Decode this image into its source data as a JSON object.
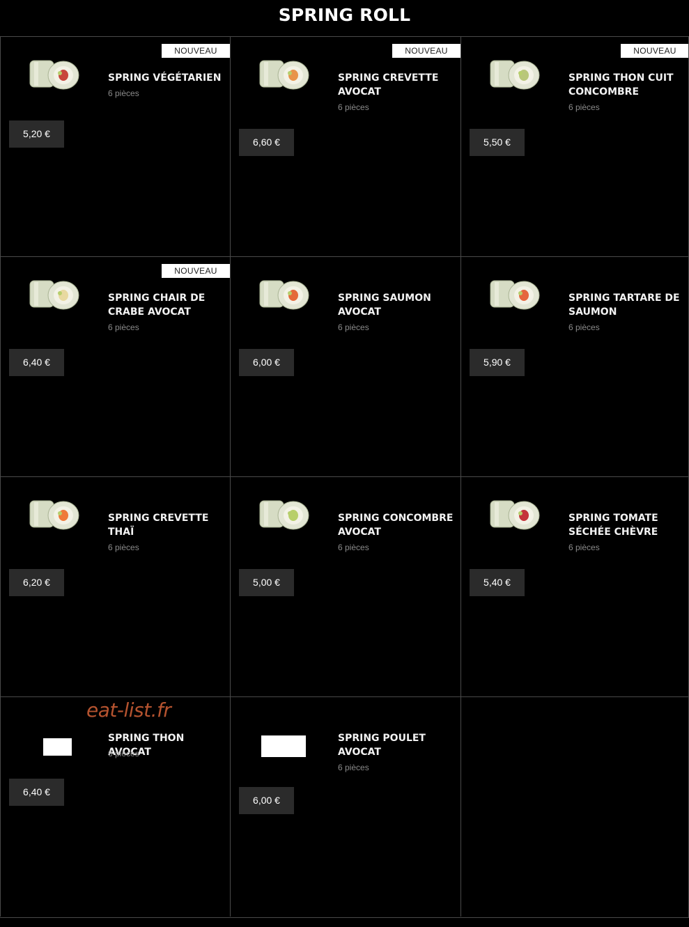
{
  "page": {
    "title": "SPRING ROLL"
  },
  "badge_label": "NOUVEAU",
  "watermark": "eat-list.fr",
  "products": [
    {
      "name": "SPRING VÉGÉTARIEN",
      "pieces": "6 pièces",
      "price": "5,20 €",
      "badge": true,
      "filling": "#c8463c"
    },
    {
      "name": "SPRING CREVETTE AVOCAT",
      "pieces": "6 pièces",
      "price": "6,60 €",
      "badge": true,
      "filling": "#e8944a"
    },
    {
      "name": "SPRING THON CUIT CONCOMBRE",
      "pieces": "6 pièces",
      "price": "5,50 €",
      "badge": true,
      "filling": "#b9c77a"
    },
    {
      "name": "SPRING CHAIR DE CRABE AVOCAT",
      "pieces": "6 pièces",
      "price": "6,40 €",
      "badge": true,
      "filling": "#e8d9a0"
    },
    {
      "name": "SPRING SAUMON AVOCAT",
      "pieces": "6 pièces",
      "price": "6,00 €",
      "badge": false,
      "filling": "#e46a3a"
    },
    {
      "name": "SPRING TARTARE DE SAUMON",
      "pieces": "6 pièces",
      "price": "5,90 €",
      "badge": false,
      "filling": "#e5673e"
    },
    {
      "name": "SPRING CREVETTE THAÏ",
      "pieces": "6 pièces",
      "price": "6,20 €",
      "badge": false,
      "filling": "#ef7a3a"
    },
    {
      "name": "SPRING CONCOMBRE AVOCAT",
      "pieces": "6 pièces",
      "price": "5,00 €",
      "badge": false,
      "filling": "#b8cf6a"
    },
    {
      "name": "SPRING TOMATE SÉCHÉE CHÈVRE",
      "pieces": "6 pièces",
      "price": "5,40 €",
      "badge": false,
      "filling": "#c4343a"
    },
    {
      "name": "SPRING THON AVOCAT",
      "pieces": "6 pièces",
      "price": "6,40 €",
      "badge": false,
      "filling": ""
    },
    {
      "name": "SPRING POULET AVOCAT",
      "pieces": "6 pièces",
      "price": "6,00 €",
      "badge": false,
      "filling": ""
    }
  ],
  "colors": {
    "background": "#000000",
    "price_bg": "#2b2b2b",
    "badge_bg": "#ffffff",
    "pieces_text": "#8a8a8a",
    "grid_line": "#4a4a4a",
    "watermark": "#b5532f"
  }
}
